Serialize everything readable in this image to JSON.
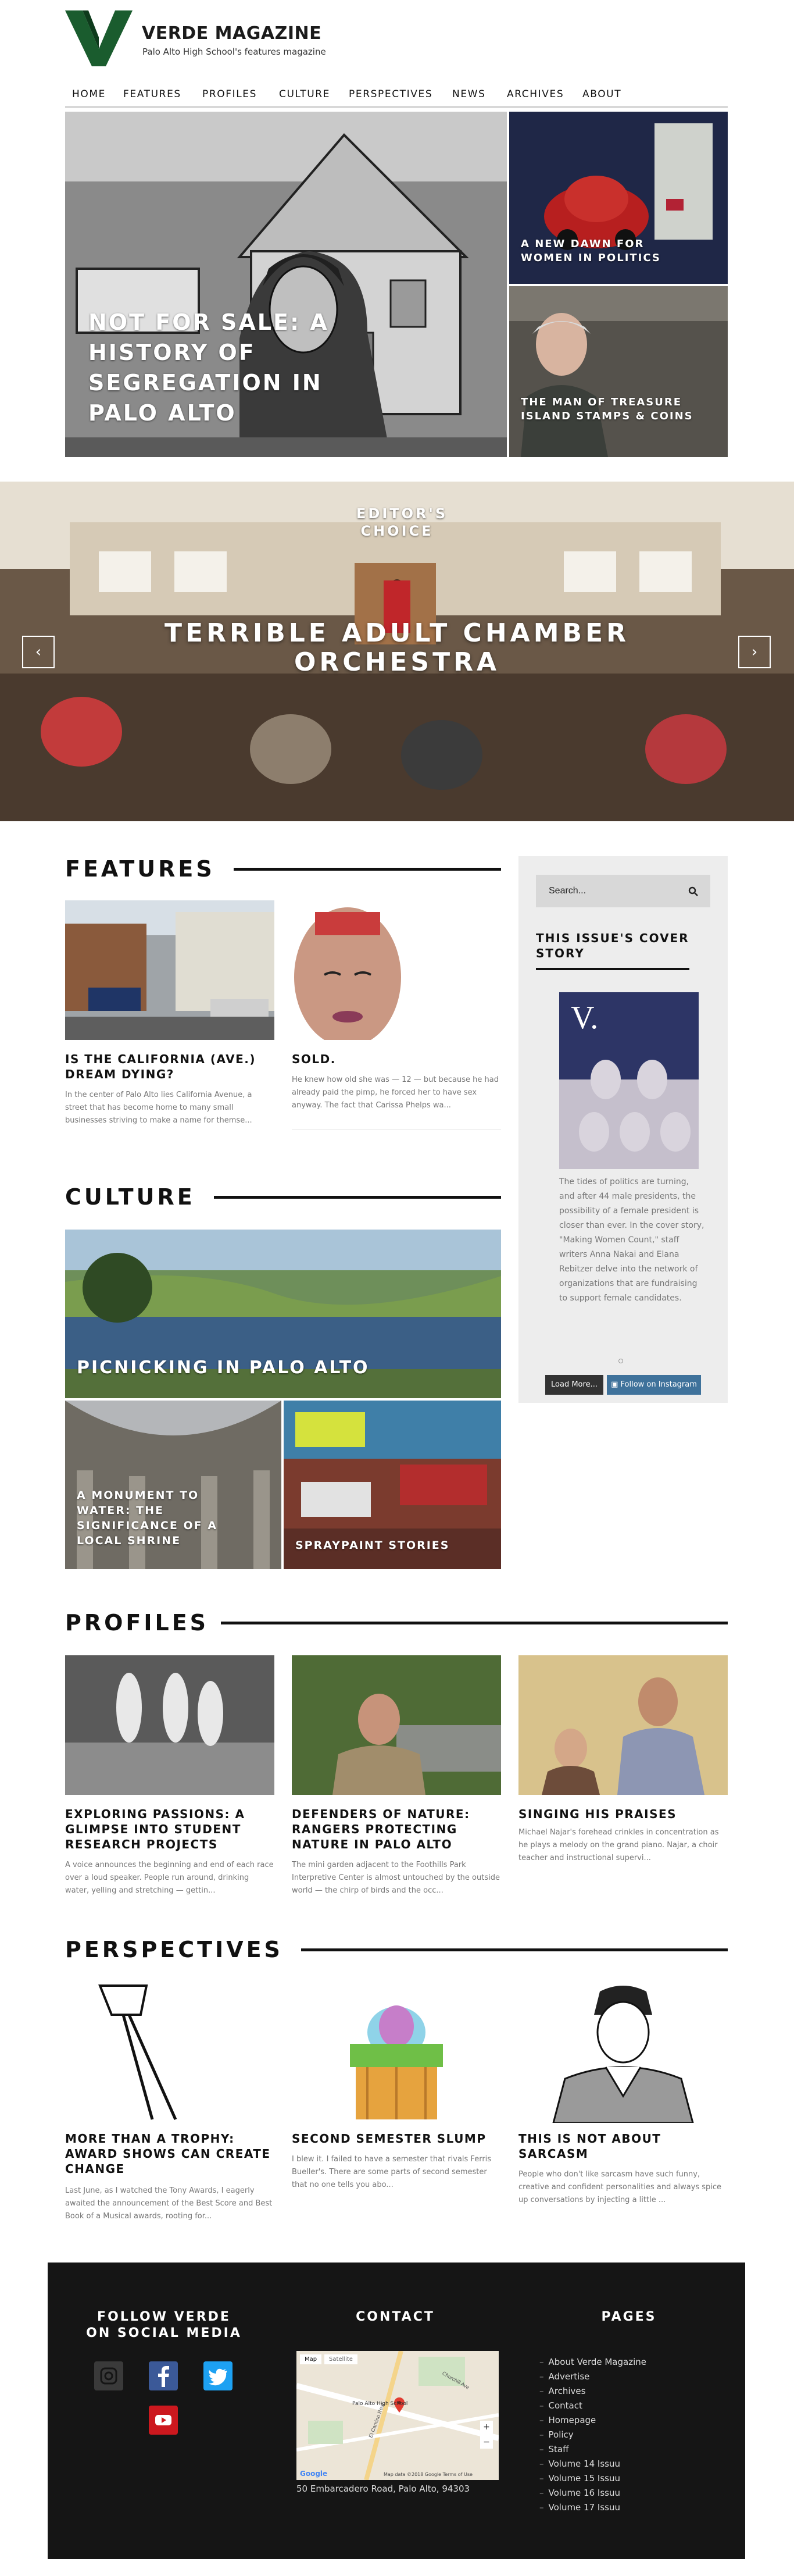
{
  "brand": {
    "title": "VERDE MAGAZINE",
    "subtitle": "Palo Alto High School's features magazine",
    "accent": "#1a5c2e"
  },
  "nav": {
    "items": [
      "HOME",
      "FEATURES",
      "PROFILES",
      "CULTURE",
      "PERSPECTIVES",
      "NEWS",
      "ARCHIVES",
      "ABOUT"
    ]
  },
  "hero": {
    "main_title": "NOT FOR SALE: A HISTORY OF SEGREGATION IN PALO ALTO",
    "side1_title": "A NEW DAWN FOR WOMEN IN POLITICS",
    "side2_title": "THE MAN OF TREASURE ISLAND STAMPS & COINS"
  },
  "slider": {
    "label": "EDITOR'S CHOICE",
    "title": "TERRIBLE ADULT CHAMBER ORCHESTRA",
    "prev_icon": "arrow-left-icon",
    "next_icon": "arrow-right-icon"
  },
  "features": {
    "heading": "FEATURES",
    "articles": [
      {
        "title": "IS THE CALIFORNIA (AVE.) DREAM DYING?",
        "excerpt": "In the center of Palo Alto lies California Avenue, a street that has become home to many small businesses striving to make a name for themse..."
      },
      {
        "title": "SOLD.",
        "excerpt": "He knew how old she was — 12 — but because he had already paid the pimp, he forced her to have sex anyway. The fact that Carissa Phelps wa..."
      }
    ]
  },
  "sidebar": {
    "search_placeholder": "Search...",
    "search_icon": "search-icon",
    "cover_heading": "THIS ISSUE'S COVER STORY",
    "cover_text": "The tides of politics are turning, and after 44 male presidents, the possibility of a female president is closer than ever. In the cover story, \"Making Women Count,\" staff writers Anna Nakai and Elana Rebitzer delve into the network of organizations that are fundraising to support female candidates.",
    "load_more": "Load More...",
    "instagram": "Follow on Instagram",
    "cover_letter": "V."
  },
  "culture": {
    "heading": "CULTURE",
    "main_title": "PICNICKING IN PALO ALTO",
    "left_title": "A MONUMENT TO WATER: THE SIGNIFICANCE OF A LOCAL SHRINE",
    "right_title": "SPRAYPAINT STORIES"
  },
  "profiles": {
    "heading": "PROFILES",
    "articles": [
      {
        "title": "EXPLORING PASSIONS: A GLIMPSE INTO STUDENT RESEARCH PROJECTS",
        "excerpt": "A voice announces the beginning and end of each race over a loud speaker. People run around, drinking water, yelling and stretching — gettin..."
      },
      {
        "title": "DEFENDERS OF NATURE: RANGERS PROTECTING NATURE IN PALO ALTO",
        "excerpt": "The mini garden adjacent to the Foothills Park Interpretive Center is almost untouched by the outside world — the chirp of birds and the occ..."
      },
      {
        "title": "SINGING HIS PRAISES",
        "excerpt": "Michael Najar's forehead crinkles in concentration as he plays a melody on the grand piano. Najar, a choir teacher and instructional supervi..."
      }
    ]
  },
  "perspectives": {
    "heading": "PERSPECTIVES",
    "articles": [
      {
        "title": "MORE THAN A TROPHY: AWARD SHOWS CAN CREATE CHANGE",
        "excerpt": "Last June, as I watched the Tony Awards, I eagerly awaited the announcement of the Best Score and Best Book of a Musical awards, rooting for..."
      },
      {
        "title": "SECOND SEMESTER SLUMP",
        "excerpt": "I blew it. I failed to have a semester that rivals Ferris Bueller's. There are some parts of second semester that no one tells you abo..."
      },
      {
        "title": "THIS IS NOT ABOUT SARCASM",
        "excerpt": "People who don't like sarcasm have such funny, creative and confident personalities and always spice up conversations by injecting a little ..."
      }
    ]
  },
  "footer": {
    "social_heading": "FOLLOW VERDE ON SOCIAL MEDIA",
    "contact_heading": "CONTACT",
    "pages_heading": "PAGES",
    "address": "50 Embarcadero Road, Palo Alto, 94303",
    "map_tab_map": "Map",
    "map_tab_sat": "Satellite",
    "map_pin_label": "Palo Alto High School",
    "map_google": "Google",
    "map_terms": "Map data ©2018 Google   Terms of Use",
    "map_street1": "Churchill Ave",
    "map_street2": "El Camino Real",
    "pages": [
      "About Verde Magazine",
      "Advertise",
      "Archives",
      "Contact",
      "Homepage",
      "Policy",
      "Staff",
      "Volume 14 Issuu",
      "Volume 15 Issuu",
      "Volume 16 Issuu",
      "Volume 17 Issuu"
    ],
    "social_colors": {
      "instagram": "#3a3a3a",
      "facebook": "#3b5998",
      "twitter": "#1da1f2",
      "youtube": "#cc181e"
    }
  }
}
